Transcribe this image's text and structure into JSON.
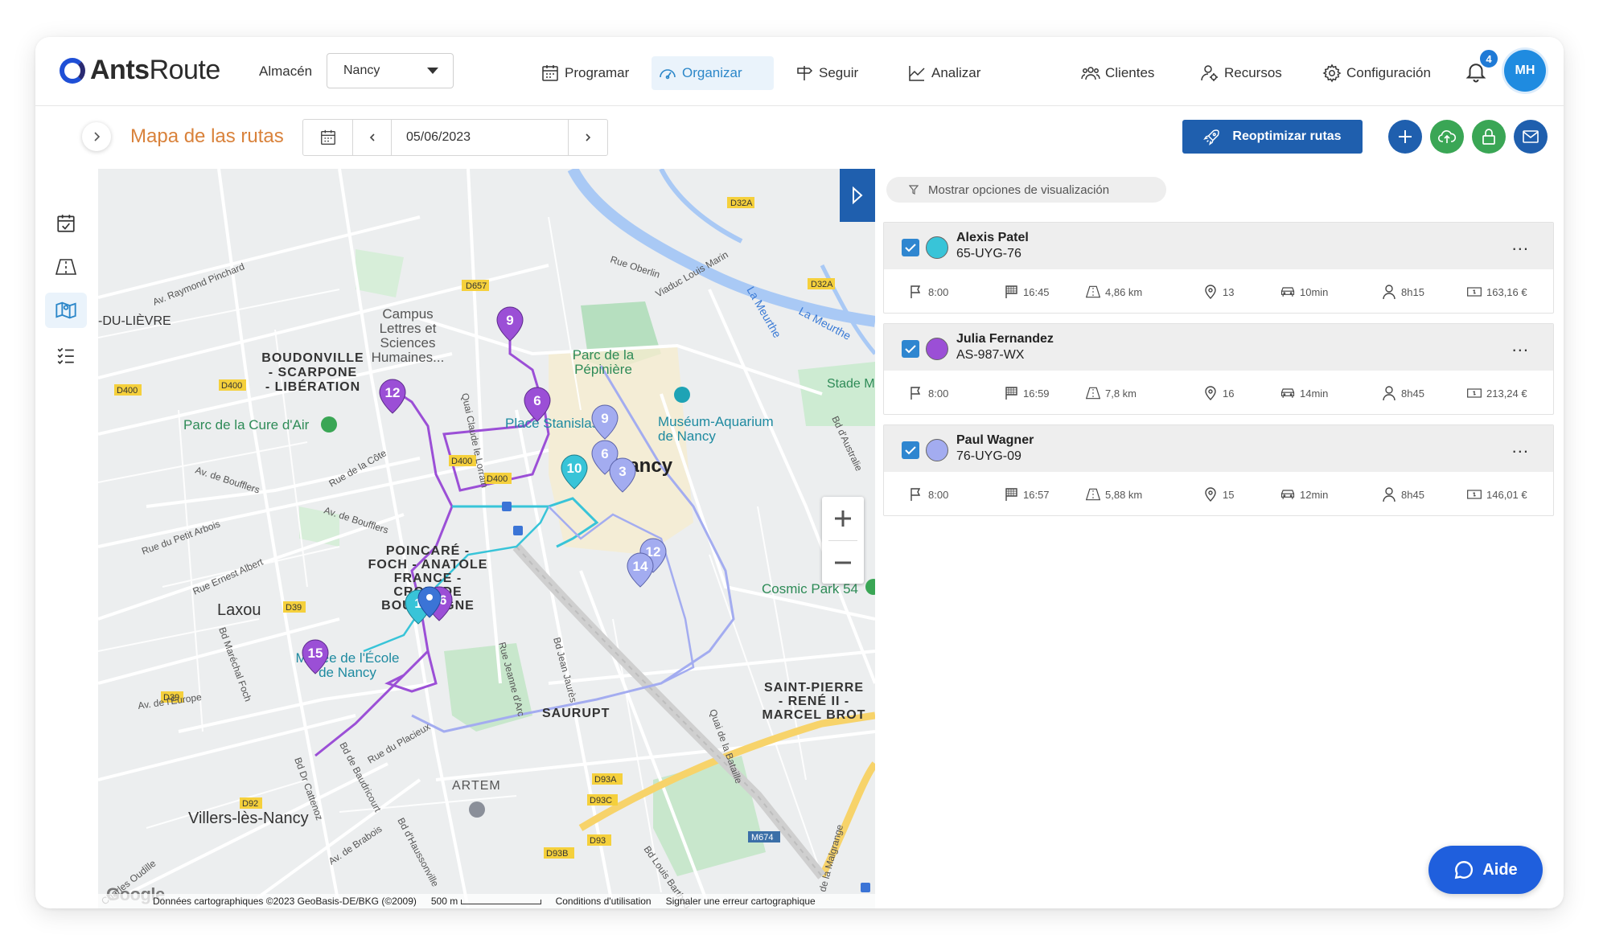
{
  "app": {
    "logo_text_bold": "Ants",
    "logo_text_rest": "Route",
    "store_label": "Almacén",
    "store_value": "Nancy",
    "nav": [
      {
        "label": "Programar",
        "icon": "calendar-icon"
      },
      {
        "label": "Organizar",
        "icon": "dashboard-icon",
        "active": true
      },
      {
        "label": "Seguir",
        "icon": "signpost-icon"
      },
      {
        "label": "Analizar",
        "icon": "chart-icon"
      },
      {
        "label": "Clientes",
        "icon": "clients-icon"
      },
      {
        "label": "Recursos",
        "icon": "resources-icon"
      },
      {
        "label": "Configuración",
        "icon": "gear-icon"
      }
    ],
    "notifications_count": "4",
    "avatar_initials": "MH"
  },
  "subheader": {
    "title": "Mapa de las rutas",
    "date": "05/06/2023",
    "reoptimize_label": "Reoptimizar rutas"
  },
  "colors": {
    "brand_blue": "#1f5fae",
    "title_orange": "#d9823b",
    "green": "#3aa655",
    "route_cyan": "#38c4d8",
    "route_purple": "#9b4fd6",
    "route_lavender": "#a3acf0"
  },
  "map": {
    "labels": {
      "campus": "Campus\nLettres et\nSciences\nHumaines...",
      "boudonville": "BOUDONVILLE\n- SCARPONE\n- LIBÉRATION",
      "parc_cure": "Parc de la Cure d'Air",
      "parc_pepiniere": "Parc de la\nPépinière",
      "museum": "Muséum-Aquarium\nde Nancy",
      "nancy": "Nancy",
      "stade": "Stade M",
      "place_stanislas": "Place Stanislas",
      "poincare": "POINCARÉ -\nFOCH - ANATOLE\nFRANCE -\nCROIX DE\nBOURGOGNE",
      "laxou": "Laxou",
      "musee_ecole": "Musée de l'École\nde Nancy",
      "cosmic": "Cosmic Park 54",
      "saint_pierre": "SAINT-PIERRE\n- RENÉ II -\nMARCEL BROT",
      "saurupt": "SAURUPT",
      "artem": "ARTEM",
      "villers": "Villers-lès-Nancy",
      "du_lievre": "-DU-LIÈVRE",
      "la_meurthe": "La Meurthe",
      "rue_oberlin": "Rue Oberlin",
      "viaduc": "Viaduc Louis Marin",
      "av_raymond": "Av. Raymond Pinchard",
      "rue_cote": "Rue de la Côte",
      "av_boufflers": "Av. de Boufflers",
      "rue_petit_arbois": "Rue du Petit Arbois",
      "rue_ernest": "Rue Ernest Albert",
      "quai_claude": "Quai Claude le Lorrain",
      "bd_europe": "Av. de l'Europe",
      "bd_marechal": "Bd Maréchal Foch",
      "bd_australie": "Bd d'Australie",
      "rue_placieux": "Rue du Placieux",
      "bd_jean_jaures": "Bd Jean Jaurès",
      "rue_jeanne": "Rue Jeanne d'Arc",
      "quai_bataille": "Quai de la Bataille",
      "bd_baudricourt": "Bd de Baudricourt",
      "bd_cattenoz": "Bd Dr Cattenoz",
      "av_brabois": "Av. de Brabois",
      "bd_haussonville": "Bd d'Haussonville",
      "charles_oudille": "Charles Oudille",
      "bd_louis": "Bd Louis Barthou",
      "malgrange": "de la Malgrange",
      "road_d657": "D657",
      "road_d400a": "D400",
      "road_d400b": "D400",
      "road_d400c": "D400",
      "road_d400d": "D400",
      "road_d32a_a": "D32A",
      "road_d32a_b": "D32A",
      "road_d39a": "D39",
      "road_d39b": "D39",
      "road_d92": "D92",
      "road_d93a": "D93A",
      "road_d93c": "D93C",
      "road_d93": "D93",
      "road_d93b": "D93B",
      "road_m674": "M674"
    },
    "pins": [
      {
        "n": "9",
        "color": "purple"
      },
      {
        "n": "12",
        "color": "purple"
      },
      {
        "n": "6",
        "color": "purple"
      },
      {
        "n": "9",
        "color": "lavender"
      },
      {
        "n": "6",
        "color": "lavender"
      },
      {
        "n": "3",
        "color": "lavender"
      },
      {
        "n": "10",
        "color": "cyan"
      },
      {
        "n": "12",
        "color": "lavender"
      },
      {
        "n": "14",
        "color": "lavender"
      },
      {
        "n": "16",
        "color": "purple"
      },
      {
        "n": "1",
        "color": "cyan"
      },
      {
        "n": "15",
        "color": "purple"
      }
    ],
    "footer": {
      "google": "Google",
      "data": "Données cartographiques ©2023 GeoBasis-DE/BKG (©2009)",
      "scale": "500 m",
      "terms": "Conditions d'utilisation",
      "report": "Signaler une erreur cartographique"
    }
  },
  "panel": {
    "viz_toggle": "Mostrar opciones de visualización",
    "routes": [
      {
        "name": "Alexis Patel",
        "plate": "65-UYG-76",
        "color": "#38c4d8",
        "start": "8:00",
        "end": "16:45",
        "distance": "4,86 km",
        "stops": "13",
        "drive": "10min",
        "work": "8h15",
        "cost": "163,16 €"
      },
      {
        "name": "Julia Fernandez",
        "plate": "AS-987-WX",
        "color": "#9b4fd6",
        "start": "8:00",
        "end": "16:59",
        "distance": "7,8 km",
        "stops": "16",
        "drive": "14min",
        "work": "8h45",
        "cost": "213,24 €"
      },
      {
        "name": "Paul Wagner",
        "plate": "76-UYG-09",
        "color": "#a3acf0",
        "start": "8:00",
        "end": "16:57",
        "distance": "5,88 km",
        "stops": "15",
        "drive": "12min",
        "work": "8h45",
        "cost": "146,01 €"
      }
    ],
    "menu_glyph": "..."
  },
  "help": {
    "label": "Aide"
  }
}
